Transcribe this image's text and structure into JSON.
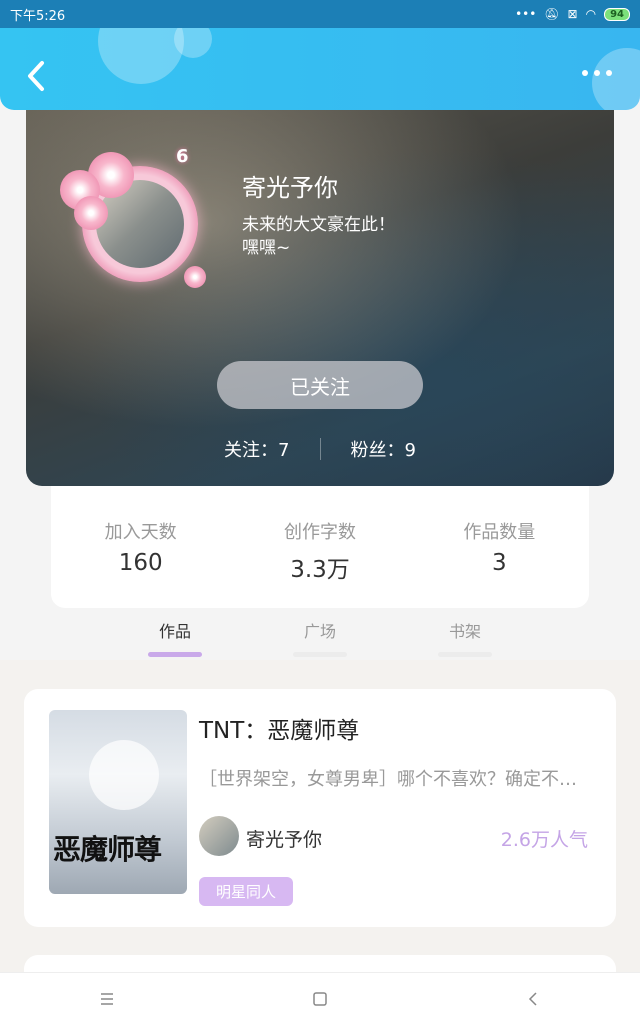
{
  "status_bar": {
    "time": "下午5:26",
    "battery": "94"
  },
  "profile": {
    "nickname": "寄光予你",
    "bio": "未来的大文豪在此！\n嘿嘿~",
    "level": "6",
    "follow_button_label": "已关注",
    "following_label": "关注：7",
    "followers_label": "粉丝：9"
  },
  "stats": [
    {
      "label": "加入天数",
      "value": "160"
    },
    {
      "label": "创作字数",
      "value": "3.3万"
    },
    {
      "label": "作品数量",
      "value": "3"
    }
  ],
  "tabs": [
    {
      "label": "作品",
      "active": true
    },
    {
      "label": "广场",
      "active": false
    },
    {
      "label": "书架",
      "active": false
    }
  ],
  "works": [
    {
      "title": "TNT：恶魔师尊",
      "description": "［世界架空，女尊男卑］哪个不喜欢？确定不要吗",
      "author": "寄光予你",
      "popularity": "2.6万人气",
      "tag": "明星同人",
      "cover_text": "恶魔师尊"
    }
  ],
  "colors": {
    "header": "#38b6f0",
    "accent": "#c9a9ea",
    "tag": "#d7b8f2"
  }
}
